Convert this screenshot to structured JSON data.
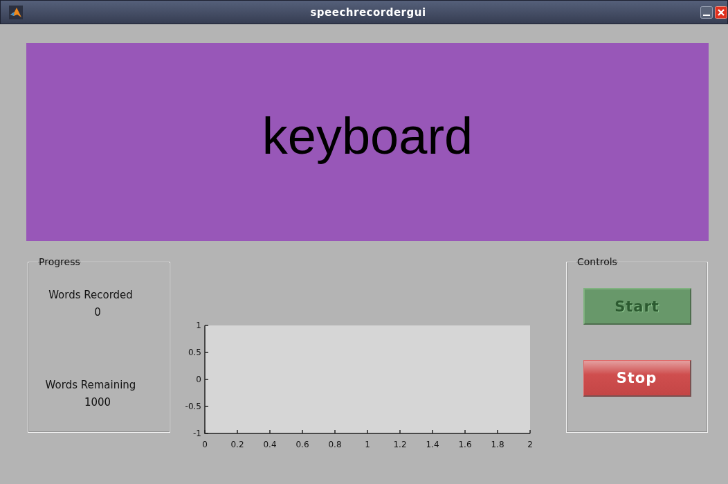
{
  "window": {
    "title": "speechrecordergui"
  },
  "prompt": {
    "word": "keyboard"
  },
  "progress": {
    "title": "Progress",
    "stats": [
      {
        "label": "Words Recorded",
        "value": "0"
      },
      {
        "label": "Words Remaining",
        "value": "1000"
      }
    ]
  },
  "plot": {
    "chart_data": {
      "type": "line",
      "xlim": [
        0,
        2
      ],
      "ylim": [
        -1,
        1
      ],
      "xticks": [
        0,
        0.2,
        0.4,
        0.6,
        0.8,
        1,
        1.2,
        1.4,
        1.6,
        1.8,
        2
      ],
      "yticks": [
        -1,
        -0.5,
        0,
        0.5,
        1
      ]
    }
  },
  "controls": {
    "title": "Controls",
    "buttons": [
      {
        "label": "Start",
        "kind": "start",
        "disabled": true
      },
      {
        "label": "Stop",
        "kind": "stop",
        "disabled": false
      }
    ]
  }
}
